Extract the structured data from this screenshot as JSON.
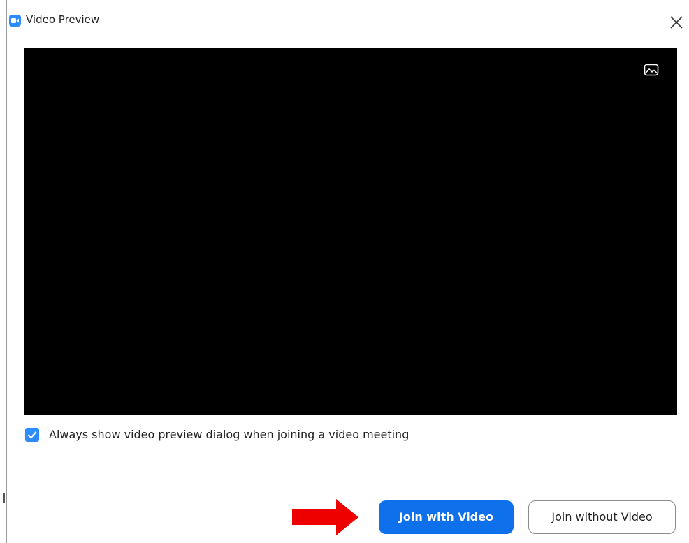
{
  "window": {
    "title": "Video Preview",
    "app_icon": "zoom-camera-icon",
    "close_icon": "close-icon"
  },
  "preview": {
    "background_color": "#000000",
    "background_button_icon": "virtual-background-icon"
  },
  "options": {
    "always_show_preview_label": "Always show video preview dialog when joining a video meeting",
    "always_show_preview_checked": true
  },
  "actions": {
    "join_with_video_label": "Join with Video",
    "join_without_video_label": "Join without Video"
  },
  "annotation": {
    "arrow_icon": "red-arrow-icon",
    "arrow_color": "#ee0000"
  },
  "colors": {
    "accent": "#2d8cff",
    "primary_button": "#0e71eb"
  }
}
